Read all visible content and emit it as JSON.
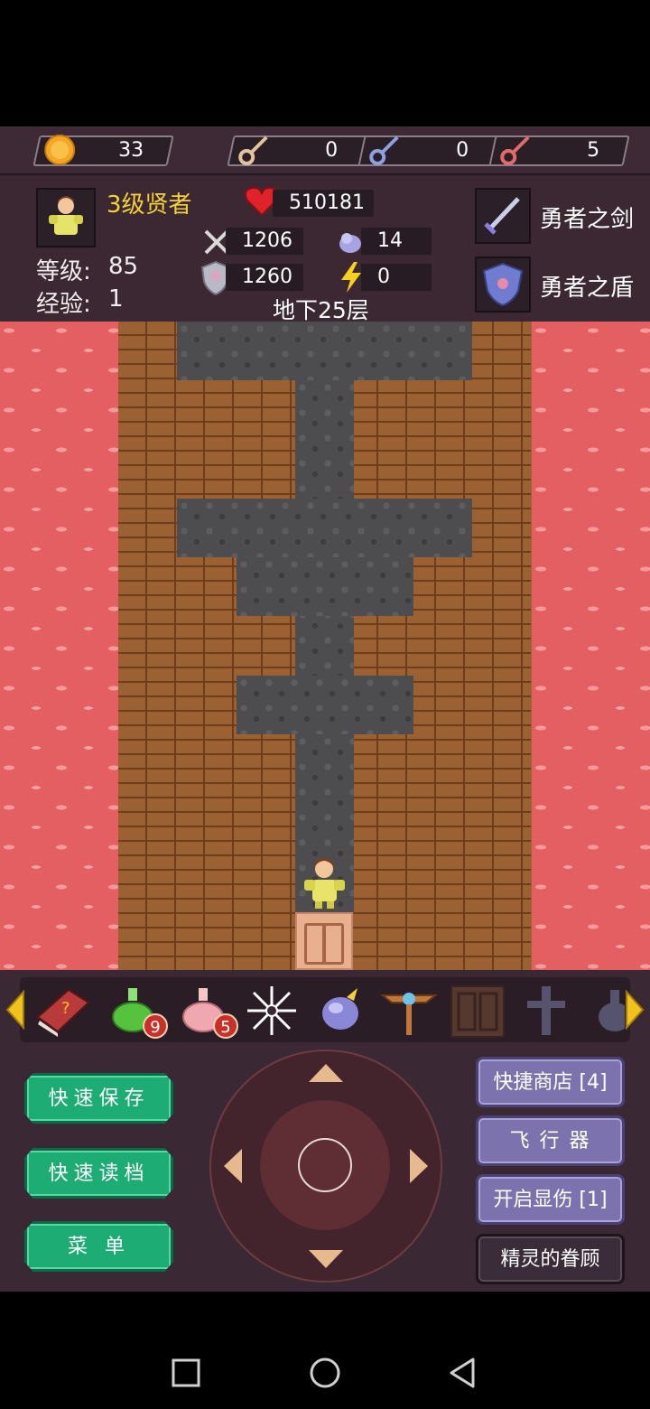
{
  "resources": {
    "gold": "33",
    "yellow_key": "0",
    "blue_key": "0",
    "red_key": "5"
  },
  "hero": {
    "title": "3级贤者",
    "level_label": "等级:",
    "level_value": "85",
    "exp_label": "经验:",
    "exp_value": "1",
    "hp": "510181",
    "atk": "1206",
    "def": "1260",
    "mdef": "14",
    "speed": "0",
    "floor": "地下25层"
  },
  "equipment": {
    "weapon": "勇者之剑",
    "armor": "勇者之盾"
  },
  "items": [
    {
      "name": "monster-manual-icon"
    },
    {
      "name": "green-potion-icon",
      "count": "9"
    },
    {
      "name": "pink-potion-icon",
      "count": "5"
    },
    {
      "name": "snowflake-icon"
    },
    {
      "name": "crystal-orb-icon"
    },
    {
      "name": "winged-staff-icon"
    },
    {
      "name": "door-item-icon"
    },
    {
      "name": "cross-item-icon"
    },
    {
      "name": "vase-item-icon"
    }
  ],
  "buttons": {
    "quick_save": "快速保存",
    "quick_load": "快速读档",
    "menu": "菜 单",
    "quick_shop": "快捷商店 [4]",
    "flyer": "飞 行 器",
    "show_damage": "开启显伤 [1]",
    "spirit_favor": "精灵的眷顾"
  },
  "colors": {
    "lava": "#e35f62",
    "brick": "#9b6132",
    "stone": "#4d4d4f",
    "gold_text": "#f2d13a",
    "green_button": "#1dac74",
    "purple_button": "#7c72ae"
  }
}
